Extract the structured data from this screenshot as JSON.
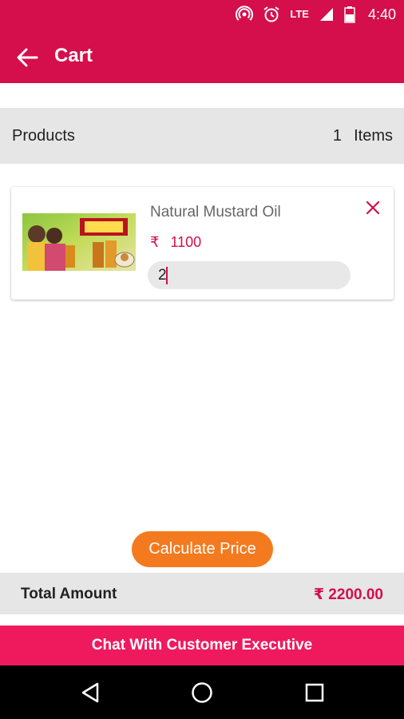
{
  "status_bar": {
    "time": "4:40",
    "network": "LTE",
    "icons": [
      "hotspot-icon",
      "alarm-icon",
      "signal-icon",
      "battery-icon"
    ]
  },
  "app_bar": {
    "title": "Cart",
    "back_icon": "arrow-left-icon"
  },
  "products_header": {
    "label": "Products",
    "count": "1",
    "items_label": "Items"
  },
  "cart_items": [
    {
      "name": "Natural Mustard Oil",
      "currency": "₹",
      "price": "1100",
      "quantity": "2",
      "remove_icon": "close-icon"
    }
  ],
  "calculate_button": "Calculate Price",
  "total": {
    "label": "Total Amount",
    "value": "₹ 2200.00"
  },
  "chat_button": "Chat With Customer Executive",
  "nav_bar": {
    "icons": [
      "back-triangle-icon",
      "home-circle-icon",
      "recents-square-icon"
    ]
  },
  "colors": {
    "primary": "#d40f4b",
    "chat_bar": "#ee1a5d",
    "accent_orange": "#f47a1f",
    "header_gray": "#e6e6e6"
  }
}
